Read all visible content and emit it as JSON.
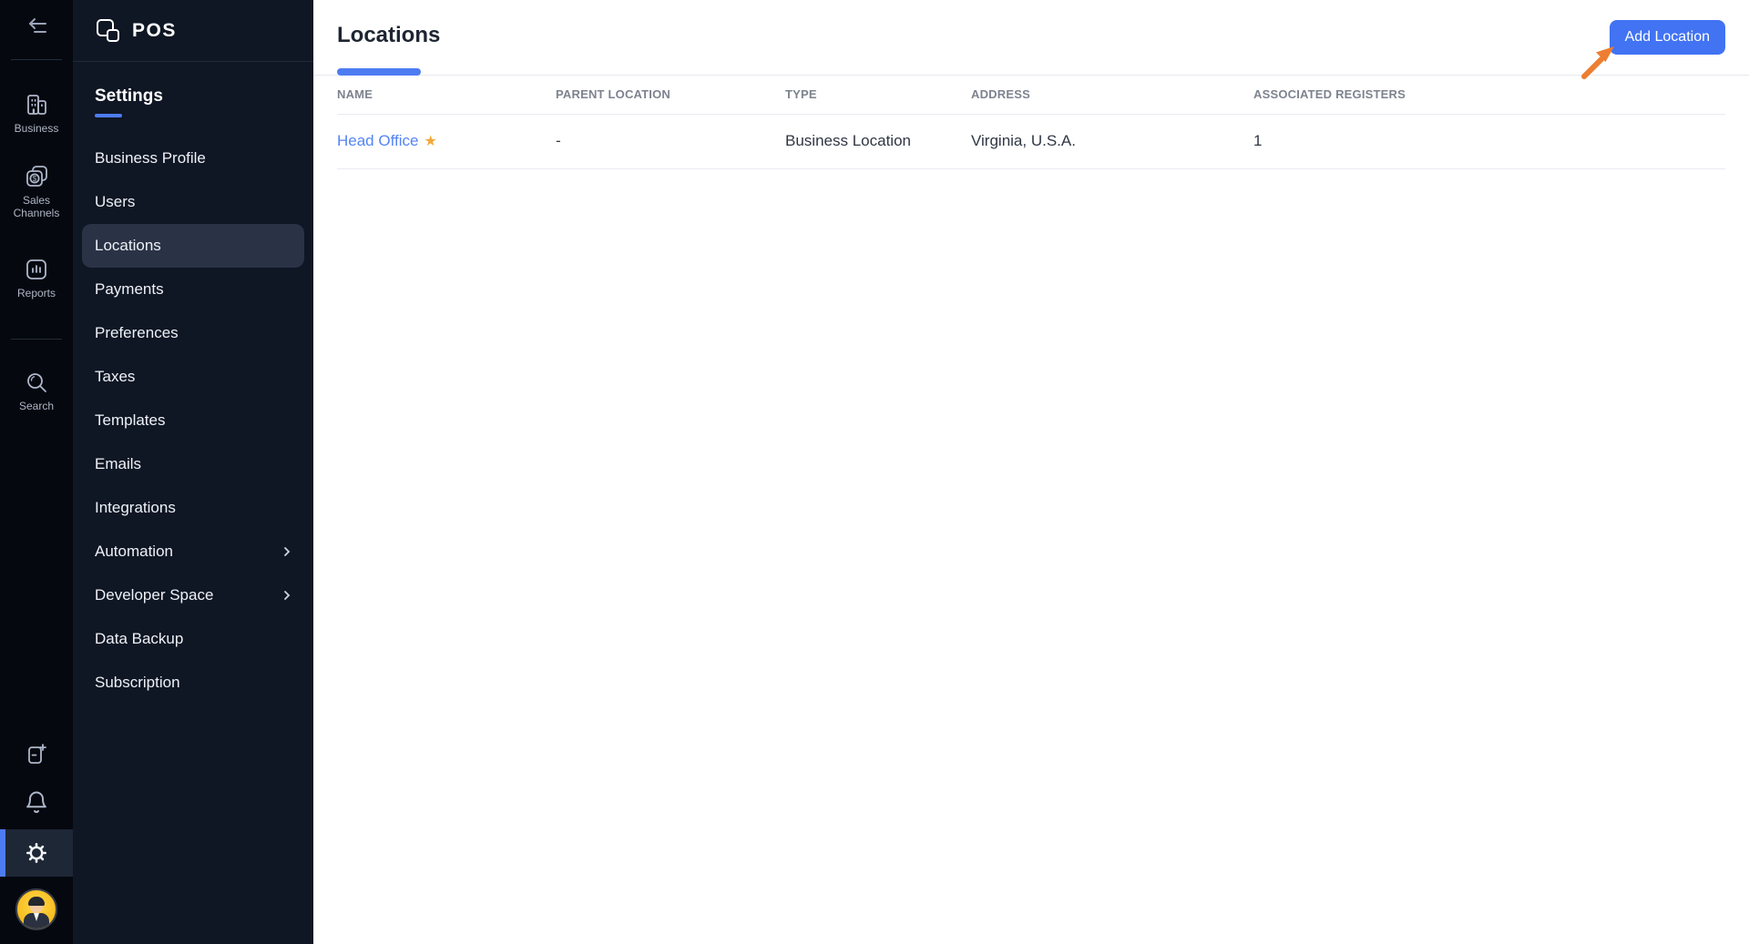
{
  "app": {
    "logo_text": "POS"
  },
  "rail": {
    "items": [
      {
        "label": "Business"
      },
      {
        "label": "Sales Channels"
      },
      {
        "label": "Reports"
      },
      {
        "label": "Search"
      }
    ]
  },
  "settings_nav": {
    "heading": "Settings",
    "items": [
      {
        "label": "Business Profile",
        "active": false,
        "has_submenu": false
      },
      {
        "label": "Users",
        "active": false,
        "has_submenu": false
      },
      {
        "label": "Locations",
        "active": true,
        "has_submenu": false
      },
      {
        "label": "Payments",
        "active": false,
        "has_submenu": false
      },
      {
        "label": "Preferences",
        "active": false,
        "has_submenu": false
      },
      {
        "label": "Taxes",
        "active": false,
        "has_submenu": false
      },
      {
        "label": "Templates",
        "active": false,
        "has_submenu": false
      },
      {
        "label": "Emails",
        "active": false,
        "has_submenu": false
      },
      {
        "label": "Integrations",
        "active": false,
        "has_submenu": false
      },
      {
        "label": "Automation",
        "active": false,
        "has_submenu": true
      },
      {
        "label": "Developer Space",
        "active": false,
        "has_submenu": true
      },
      {
        "label": "Data Backup",
        "active": false,
        "has_submenu": false
      },
      {
        "label": "Subscription",
        "active": false,
        "has_submenu": false
      }
    ]
  },
  "main": {
    "tab_label": "Locations",
    "add_button_label": "Add Location",
    "table": {
      "headers": [
        "NAME",
        "PARENT LOCATION",
        "TYPE",
        "ADDRESS",
        "ASSOCIATED REGISTERS"
      ],
      "rows": [
        {
          "name": "Head Office",
          "favorite": true,
          "parent": "-",
          "type": "Business Location",
          "address": "Virginia, U.S.A.",
          "registers": "1"
        }
      ]
    }
  },
  "colors": {
    "accent_blue": "#4d7cf2",
    "button_blue": "#4173f3",
    "link_blue": "#5584f3",
    "star_gold": "#f2a93b",
    "annotation_arrow_orange": "#ed7d31",
    "rail_bg": "#05080f",
    "panel_bg": "#0f1624",
    "active_item_bg": "#2a3346"
  }
}
